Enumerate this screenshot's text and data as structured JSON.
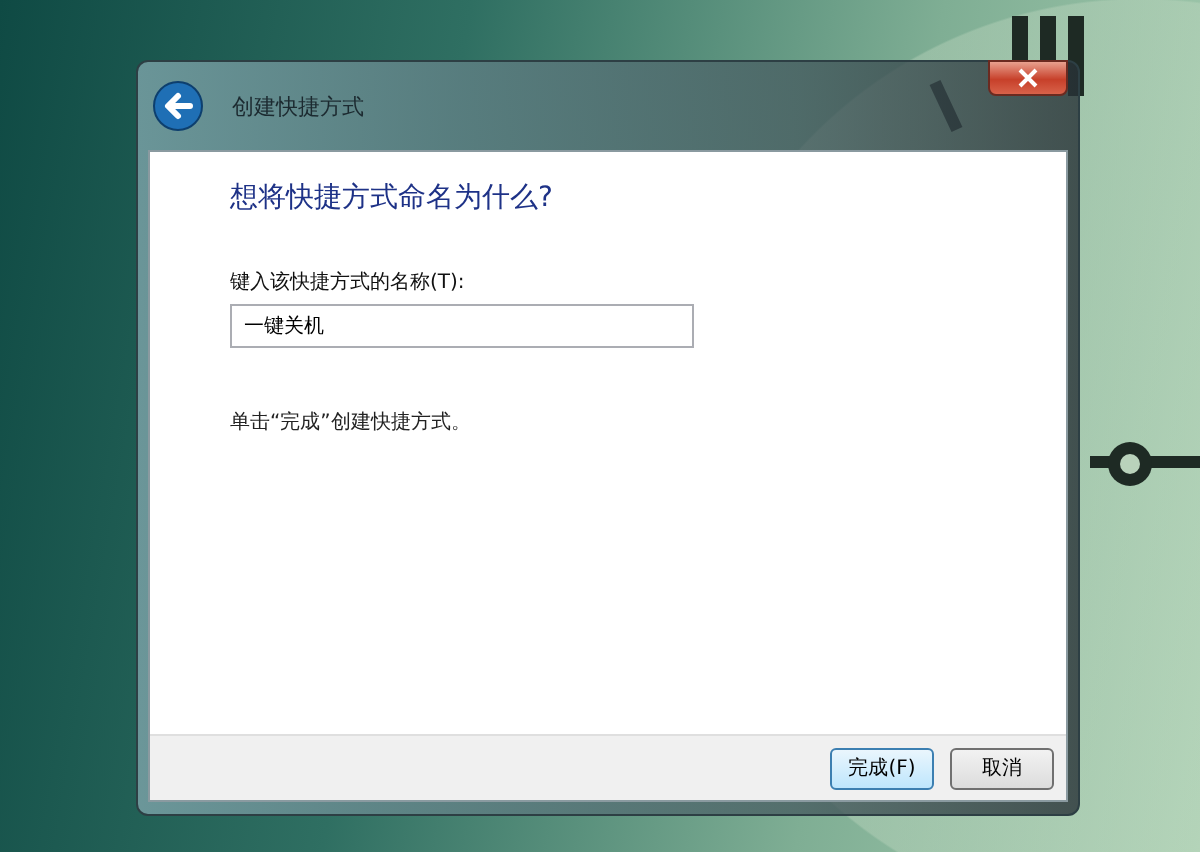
{
  "window": {
    "title": "创建快捷方式"
  },
  "heading": "想将快捷方式命名为什么?",
  "name_field": {
    "label": "键入该快捷方式的名称(T):",
    "value": "一键关机"
  },
  "instruction": "单击“完成”创建快捷方式。",
  "buttons": [
    {
      "label": "完成(F)",
      "default": true
    },
    {
      "label": "取消",
      "default": false
    }
  ]
}
